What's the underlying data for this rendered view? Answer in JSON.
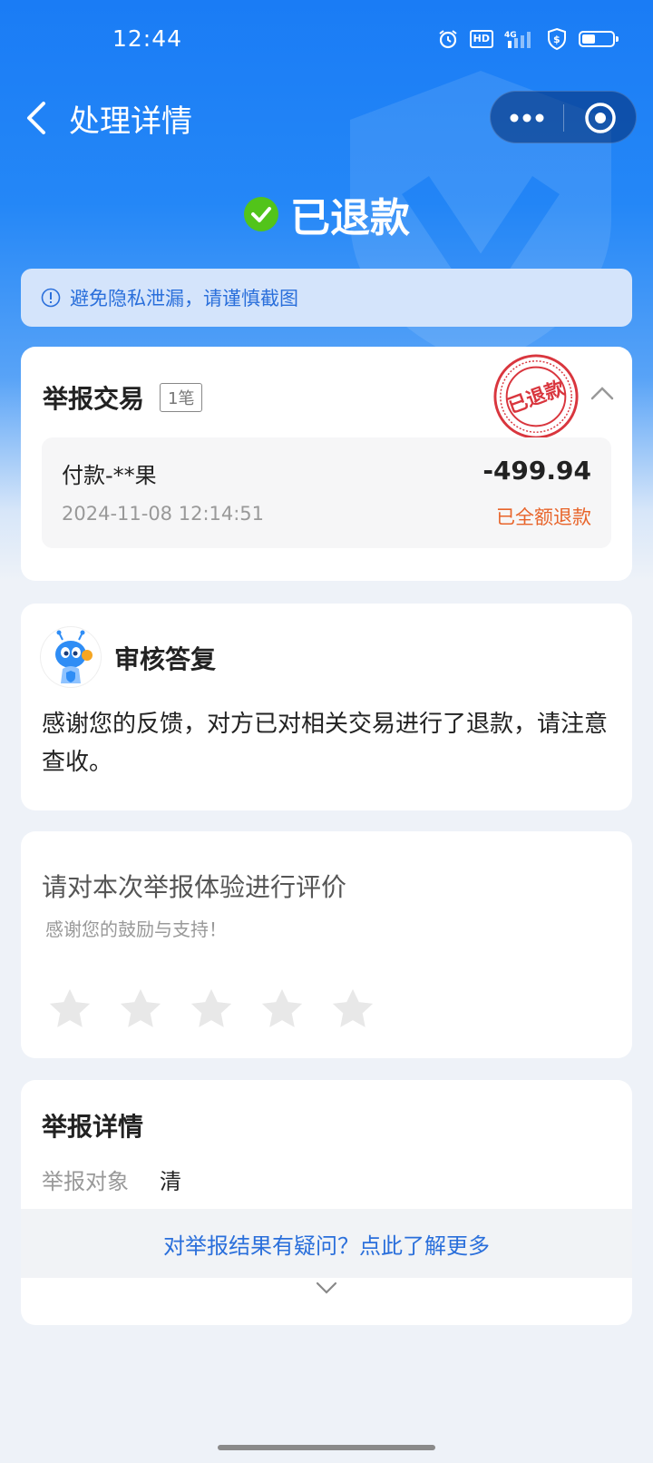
{
  "status_bar": {
    "time": "12:44",
    "network": "4G",
    "hd_label": "HD",
    "icons": [
      "alarm-icon",
      "hd-icon",
      "signal-4g-icon",
      "shield-dollar-icon",
      "battery-icon"
    ],
    "battery_level": 0.45
  },
  "nav": {
    "title": "处理详情",
    "back_icon": "chevron-left-icon",
    "more_icon": "more-dots-icon",
    "close_icon": "target-circle-icon"
  },
  "result": {
    "status": "已退款",
    "status_icon": "check-circle-icon"
  },
  "notice": {
    "text": "避免隐私泄漏，请谨慎截图",
    "icon": "info-icon"
  },
  "report_transaction": {
    "title": "举报交易",
    "count_badge": "1笔",
    "stamp_text": "已退款",
    "transaction": {
      "name": "付款-**果",
      "amount": "-499.94",
      "datetime": "2024-11-08 12:14:51",
      "status": "已全额退款"
    }
  },
  "review_reply": {
    "title": "审核答复",
    "body": "感谢您的反馈，对方已对相关交易进行了退款，请注意查收。"
  },
  "rating": {
    "title": "请对本次举报体验进行评价",
    "subtitle": "感谢您的鼓励与支持！",
    "max_stars": 5,
    "value": 0
  },
  "report_details": {
    "title": "举报详情",
    "target_label": "举报对象",
    "target_value": "清",
    "question_link": "对举报结果有疑问？点此了解更多"
  },
  "colors": {
    "brand_blue": "#1677ff",
    "link_blue": "#2a6fdb",
    "refund_orange": "#e8642a",
    "success_green": "#52c41a",
    "stamp_red": "#d9363e"
  }
}
